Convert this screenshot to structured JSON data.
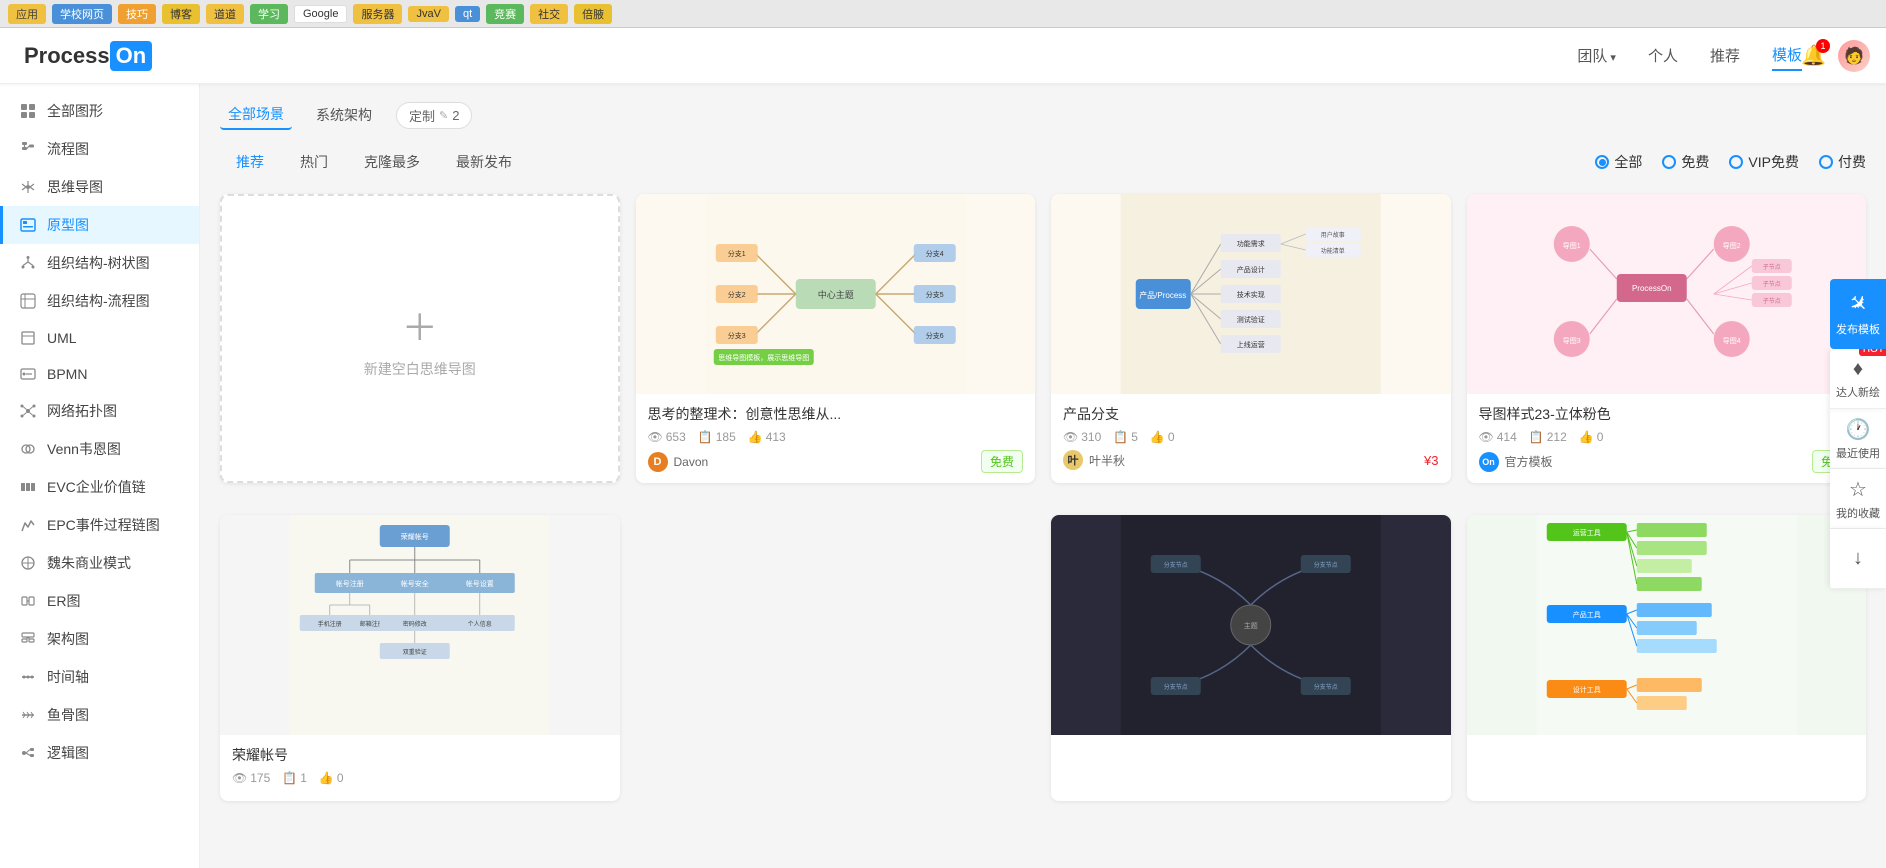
{
  "browser": {
    "bookmarks": [
      "应用",
      "学校网页",
      "技巧",
      "博客",
      "道道",
      "学习",
      "Google",
      "服务器",
      "JvaV",
      "qt",
      "竞赛",
      "社交",
      "倍腋"
    ]
  },
  "header": {
    "logo_process": "Process",
    "logo_on": "On",
    "nav": [
      {
        "label": "团队",
        "has_arrow": true,
        "active": false
      },
      {
        "label": "个人",
        "has_arrow": false,
        "active": false
      },
      {
        "label": "推荐",
        "has_arrow": false,
        "active": false
      },
      {
        "label": "模板",
        "has_arrow": false,
        "active": true
      }
    ],
    "bell_count": "1",
    "avatar_emoji": "👤"
  },
  "sidebar": {
    "items": [
      {
        "id": "all-shapes",
        "label": "全部图形",
        "icon": "grid"
      },
      {
        "id": "flowchart",
        "label": "流程图",
        "icon": "flow"
      },
      {
        "id": "mindmap",
        "label": "思维导图",
        "icon": "mind"
      },
      {
        "id": "prototype",
        "label": "原型图",
        "icon": "proto",
        "active": true
      },
      {
        "id": "org-tree",
        "label": "组织结构-树状图",
        "icon": "org"
      },
      {
        "id": "org-flow",
        "label": "组织结构-流程图",
        "icon": "orgflow"
      },
      {
        "id": "uml",
        "label": "UML",
        "icon": "uml"
      },
      {
        "id": "bpmn",
        "label": "BPMN",
        "icon": "bpmn"
      },
      {
        "id": "network",
        "label": "网络拓扑图",
        "icon": "network"
      },
      {
        "id": "venn",
        "label": "Venn韦恩图",
        "icon": "venn"
      },
      {
        "id": "evc",
        "label": "EVC企业价值链",
        "icon": "evc"
      },
      {
        "id": "epc",
        "label": "EPC事件过程链图",
        "icon": "epc"
      },
      {
        "id": "mz",
        "label": "魏朱商业模式",
        "icon": "mz"
      },
      {
        "id": "er",
        "label": "ER图",
        "icon": "er"
      },
      {
        "id": "arch",
        "label": "架构图",
        "icon": "arch"
      },
      {
        "id": "timeline",
        "label": "时间轴",
        "icon": "timeline"
      },
      {
        "id": "fishbone",
        "label": "鱼骨图",
        "icon": "fish"
      },
      {
        "id": "logic",
        "label": "逻辑图",
        "icon": "logic"
      }
    ]
  },
  "scene_tabs": [
    {
      "label": "全部场景",
      "active": true
    },
    {
      "label": "系统架构",
      "active": false
    },
    {
      "label": "定制✎",
      "active": false,
      "custom": true,
      "count": "2"
    }
  ],
  "filter_tabs": [
    {
      "label": "推荐",
      "active": true
    },
    {
      "label": "热门",
      "active": false
    },
    {
      "label": "克隆最多",
      "active": false
    },
    {
      "label": "最新发布",
      "active": false
    }
  ],
  "filter_options": [
    {
      "label": "全部",
      "value": "all",
      "checked": true
    },
    {
      "label": "免费",
      "value": "free",
      "checked": false
    },
    {
      "label": "VIP免费",
      "value": "vip",
      "checked": false
    },
    {
      "label": "付费",
      "value": "paid",
      "checked": false
    }
  ],
  "new_card": {
    "icon": "+",
    "label": "新建空白思维导图"
  },
  "cards": [
    {
      "id": "card1",
      "thumb_type": "mindmap_yellow",
      "title": "思考的整理术：创意性思维从...",
      "views": "653",
      "clones": "185",
      "likes": "413",
      "author_name": "Davon",
      "author_color": "#e67e22",
      "author_initial": "D",
      "price_type": "free",
      "price_label": "免费"
    },
    {
      "id": "card2",
      "thumb_type": "mindmap_yellow2",
      "title": "产品分支",
      "views": "310",
      "clones": "5",
      "likes": "0",
      "author_name": "叶半秋",
      "author_color": "#e8c86a",
      "author_initial": "叶",
      "price_type": "paid",
      "price_label": "¥3"
    },
    {
      "id": "card3",
      "thumb_type": "pink_nodes",
      "title": "导图样式23-立体粉色",
      "views": "414",
      "clones": "212",
      "likes": "0",
      "author_name": "官方模板",
      "author_color": "#1890ff",
      "author_initial": "On",
      "price_type": "free",
      "price_label": "免费",
      "is_official": true
    },
    {
      "id": "card4",
      "thumb_type": "tree_green",
      "title": "荣耀帐号",
      "views": "175",
      "clones": "1",
      "likes": "0",
      "author_name": "",
      "author_color": "#ccc",
      "author_initial": "",
      "price_type": "",
      "price_label": ""
    },
    {
      "id": "card5",
      "thumb_type": "dark_curve",
      "title": "",
      "views": "",
      "clones": "",
      "likes": "",
      "author_name": "",
      "author_color": "#ccc",
      "author_initial": "",
      "price_type": "",
      "price_label": ""
    }
  ],
  "float_panel": {
    "publish_label": "发布模板",
    "publish_icon": "✈",
    "buttons": [
      {
        "id": "master",
        "label": "达人新绘",
        "icon": "♦",
        "hot": true
      },
      {
        "id": "recent",
        "label": "最近使用",
        "icon": "🕐"
      },
      {
        "id": "favorite",
        "label": "我的收藏",
        "icon": "☆"
      },
      {
        "id": "download",
        "label": "↓",
        "icon": "↓"
      }
    ]
  }
}
